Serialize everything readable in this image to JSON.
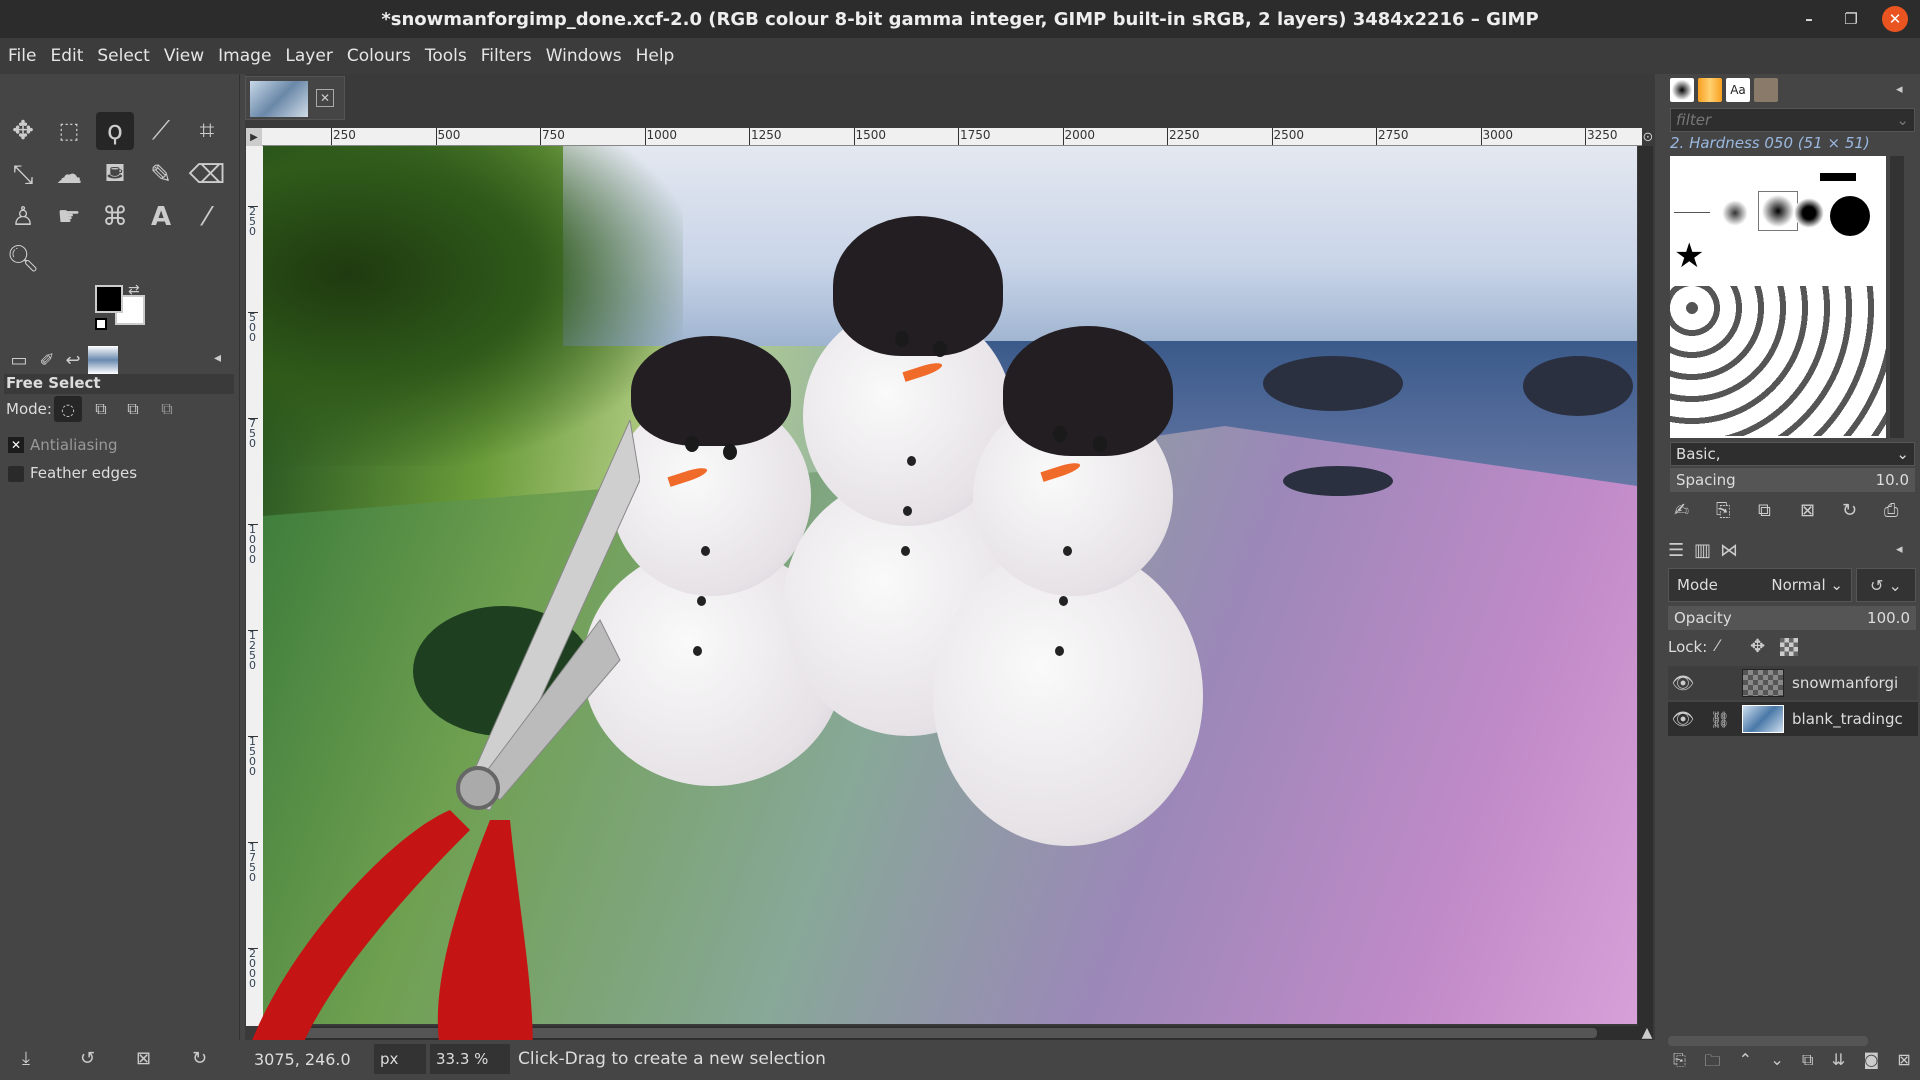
{
  "window": {
    "title": "*snowmanforgimp_done.xcf-2.0 (RGB colour 8-bit gamma integer, GIMP built-in sRGB, 2 layers) 3484x2216 – GIMP"
  },
  "menu": [
    "File",
    "Edit",
    "Select",
    "View",
    "Image",
    "Layer",
    "Colours",
    "Tools",
    "Filters",
    "Windows",
    "Help"
  ],
  "tool_options": {
    "title": "Free Select",
    "mode_label": "Mode:",
    "antialiasing": {
      "label": "Antialiasing",
      "checked": true
    },
    "feather": {
      "label": "Feather edges",
      "checked": false
    }
  },
  "colors": {
    "foreground": "#000000",
    "background": "#ffffff"
  },
  "ruler": {
    "h_labels": [
      "250",
      "500",
      "750",
      "1000",
      "1250",
      "1500",
      "1750",
      "2000",
      "2250",
      "2500",
      "2750",
      "3000",
      "3250"
    ],
    "v_labels": [
      "250",
      "500",
      "750",
      "1000",
      "1250",
      "1500",
      "1750",
      "2000"
    ]
  },
  "brushes": {
    "filter_placeholder": "filter",
    "selected": "2. Hardness 050 (51 × 51)",
    "tag": "Basic,",
    "spacing_label": "Spacing",
    "spacing_value": "10.0"
  },
  "layers_panel": {
    "mode_label": "Mode",
    "mode_value": "Normal",
    "opacity_label": "Opacity",
    "opacity_value": "100.0",
    "lock_label": "Lock:",
    "layers": [
      {
        "name": "snowmanforgi",
        "visible": true,
        "linked": false
      },
      {
        "name": "blank_tradingc",
        "visible": true,
        "linked": true
      }
    ]
  },
  "status": {
    "coords": "3075, 246.0",
    "unit": "px",
    "zoom": "33.3 %",
    "message": "Click-Drag to create a new selection"
  }
}
